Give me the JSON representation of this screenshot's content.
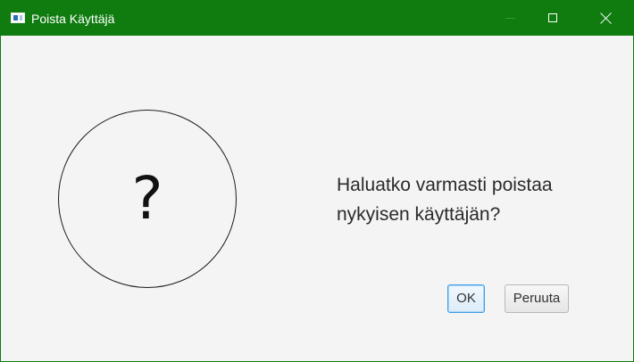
{
  "window": {
    "title": "Poista Käyttäjä",
    "accent_color": "#107c10",
    "icon": "app-window-icon"
  },
  "titlebar_controls": {
    "minimize_icon": "minimize-icon",
    "maximize_icon": "maximize-icon",
    "close_icon": "close-icon"
  },
  "dialog": {
    "icon_symbol": "?",
    "icon_name": "question-icon",
    "message": "Haluatko varmasti poistaa nykyisen käyttäjän?",
    "ok_label": "OK",
    "cancel_label": "Peruuta"
  }
}
